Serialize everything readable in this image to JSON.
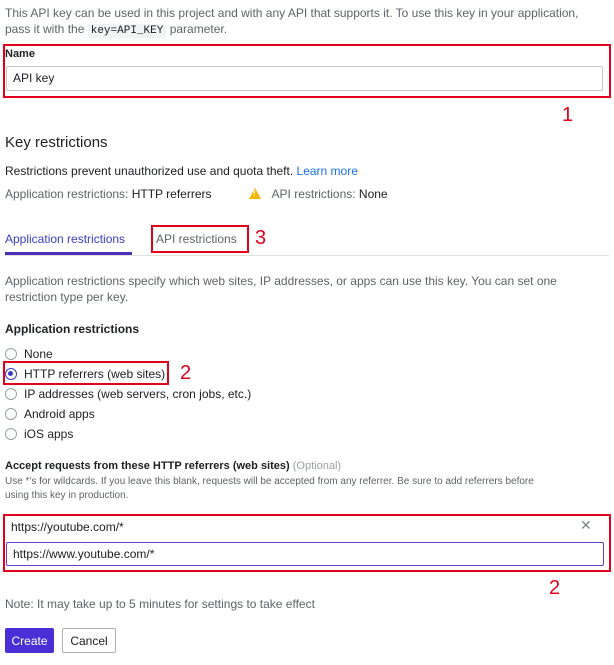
{
  "intro": {
    "line1": "This API key can be used in this project and with any API that supports it. To use this key in your application,",
    "line2_prefix": "pass it with the",
    "code": "key=API_KEY",
    "line2_suffix": "parameter."
  },
  "name_field": {
    "label": "Name",
    "value": "API key"
  },
  "key_restrictions": {
    "title": "Key restrictions",
    "desc": "Restrictions prevent unauthorized use and quota theft.",
    "learn_more": "Learn more",
    "app_restr_label": "Application restrictions:",
    "app_restr_value": "HTTP referrers",
    "api_restr_label": "API restrictions:",
    "api_restr_value": "None"
  },
  "tabs": [
    {
      "label": "Application restrictions",
      "active": true
    },
    {
      "label": "API restrictions",
      "active": false
    }
  ],
  "application_restrictions": {
    "desc1": "Application restrictions specify which web sites, IP addresses, or apps can use this key. You can set one",
    "desc2": "restriction type per key.",
    "title": "Application restrictions",
    "options": [
      {
        "label": "None",
        "selected": false
      },
      {
        "label": "HTTP referrers (web sites)",
        "selected": true
      },
      {
        "label": "IP addresses (web servers, cron jobs, etc.)",
        "selected": false
      },
      {
        "label": "Android apps",
        "selected": false
      },
      {
        "label": "iOS apps",
        "selected": false
      }
    ]
  },
  "referrers": {
    "title": "Accept requests from these HTTP referrers (web sites)",
    "optional": "(Optional)",
    "desc1": "Use *'s for wildcards. If you leave this blank, requests will be accepted from any referrer. Be sure to add referrers before",
    "desc2": "using this key in production.",
    "items": [
      "https://youtube.com/*"
    ],
    "input_value": "https://www.youtube.com/*"
  },
  "note": "Note: It may take up to 5 minutes for settings to take effect",
  "buttons": {
    "create": "Create",
    "cancel": "Cancel"
  },
  "annotations": {
    "n1": "1",
    "n2a": "2",
    "n2b": "2",
    "n3": "3"
  },
  "colors": {
    "highlight": "#e0001b",
    "accent": "#4b2fd6"
  }
}
